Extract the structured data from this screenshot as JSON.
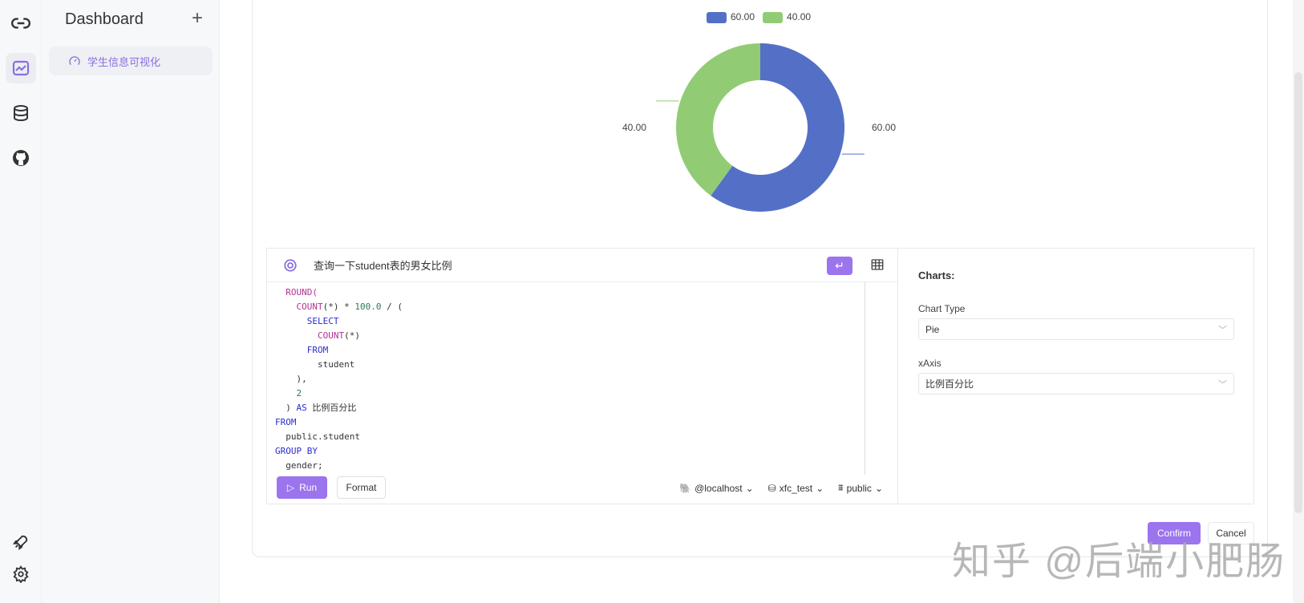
{
  "sidebar": {
    "title": "Dashboard",
    "add_icon": "+",
    "items": [
      {
        "label": "学生信息可视化",
        "icon": "gauge-icon"
      }
    ]
  },
  "rail": {
    "icons": [
      "link-icon",
      "chart-icon",
      "database-icon",
      "github-icon",
      "rocket-icon",
      "gear-icon"
    ]
  },
  "chart_data": {
    "type": "pie",
    "donut": true,
    "values": [
      60.0,
      40.0
    ],
    "labels": [
      "60.00",
      "40.00"
    ],
    "colors": [
      "#5470c6",
      "#91cc75"
    ],
    "legend": [
      "60.00",
      "40.00"
    ],
    "legend_placement": "top"
  },
  "query": {
    "prompt": "查询一下student表的男女比例",
    "run_label": "Run",
    "format_label": "Format",
    "host": "@localhost",
    "database": "xfc_test",
    "schema": "public",
    "code": [
      [
        [
          "f",
          "  ROUND("
        ]
      ],
      [
        [
          "f",
          "    COUNT"
        ],
        [
          "t",
          "(*) * "
        ],
        [
          "n",
          "100.0"
        ],
        [
          "t",
          " / ("
        ]
      ],
      [
        [
          "k",
          "      SELECT"
        ]
      ],
      [
        [
          "f",
          "        COUNT"
        ],
        [
          "t",
          "(*)"
        ]
      ],
      [
        [
          "k",
          "      FROM"
        ]
      ],
      [
        [
          "t",
          "        student"
        ]
      ],
      [
        [
          "t",
          "    ),"
        ]
      ],
      [
        [
          "n",
          "    2"
        ]
      ],
      [
        [
          "t",
          "  ) "
        ],
        [
          "k",
          "AS "
        ],
        [
          "t",
          "比例百分比"
        ]
      ],
      [
        [
          "k",
          "FROM"
        ]
      ],
      [
        [
          "t",
          "  public.student"
        ]
      ],
      [
        [
          "k",
          "GROUP BY"
        ]
      ],
      [
        [
          "t",
          "  gender;"
        ]
      ]
    ]
  },
  "charts_panel": {
    "title": "Charts:",
    "chart_type_label": "Chart Type",
    "chart_type": "Pie",
    "xaxis_label": "xAxis",
    "xaxis": "比例百分比"
  },
  "footer": {
    "confirm": "Confirm",
    "cancel": "Cancel"
  },
  "watermark": "知乎 @后端小肥肠"
}
